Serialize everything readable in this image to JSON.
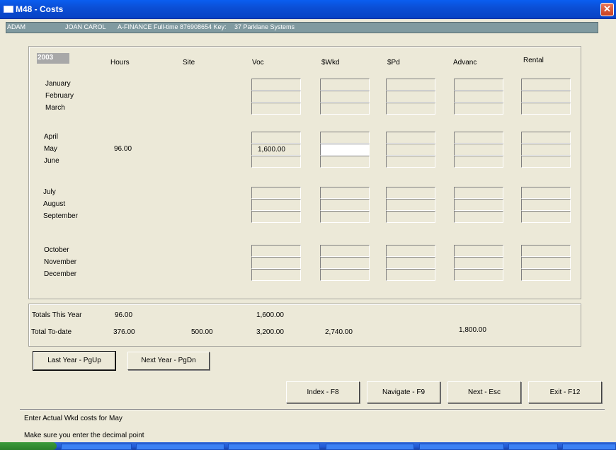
{
  "window": {
    "title": "M48  -  Costs",
    "close_glyph": "✕"
  },
  "infobar": {
    "surname": "ADAM",
    "first_names": "JOAN CAROL",
    "details": "A-FINANCE  Full-time 876908654 Key:",
    "company": "37 Parklane Systems"
  },
  "grid": {
    "year": "2003",
    "columns": [
      "Hours",
      "Site",
      "Voc",
      "$Wkd",
      "$Pd",
      "Advanc",
      "Rental"
    ],
    "months": [
      "January",
      "February",
      "March",
      "April",
      "May",
      "June",
      "July",
      "August",
      "September",
      "October",
      "November",
      "December"
    ],
    "hours": {
      "May": "96.00"
    },
    "values": {
      "May": {
        "Voc": "1,600.00",
        "$Wkd": "",
        "$Pd": "",
        "Advanc": "",
        "Rental": ""
      }
    },
    "active_cell": {
      "month": "May",
      "column": "$Wkd"
    }
  },
  "totals": {
    "this_year_label": "Totals This Year",
    "this_year_hours": "96.00",
    "this_year_voc": "1,600.00",
    "to_date_label": "Total To-date",
    "to_date_hours": "376.00",
    "to_date_site": "500.00",
    "to_date_voc": "3,200.00",
    "to_date_wkd": "2,740.00",
    "to_date_rental": "1,800.00"
  },
  "buttons": {
    "last_year": "Last Year - PgUp",
    "next_year": "Next Year - PgDn",
    "index": "Index - F8",
    "navigate": "Navigate - F9",
    "next": "Next - Esc",
    "exit": "Exit - F12"
  },
  "status": {
    "line1": "Enter Actual Wkd   costs for May",
    "line2": "Make sure you enter the decimal point"
  },
  "colors": {
    "titlebar": "#0b4fd6",
    "infobar": "#809aa0",
    "window_bg": "#ece9d8",
    "close_button": "#d4532e"
  }
}
